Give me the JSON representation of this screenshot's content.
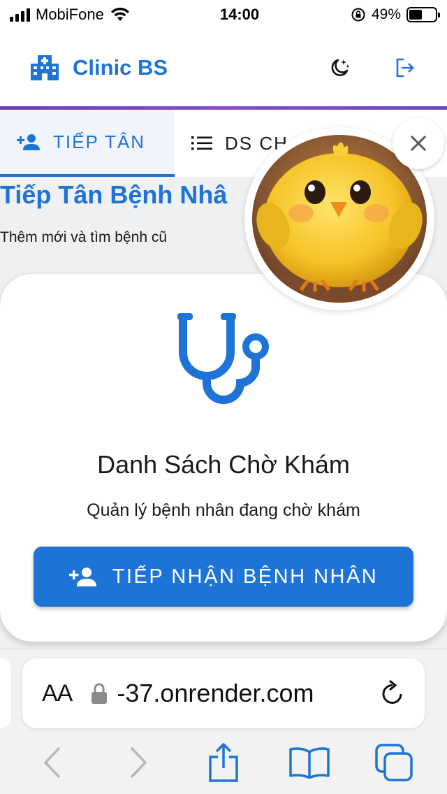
{
  "status_bar": {
    "carrier": "MobiFone",
    "time": "14:00",
    "battery_percent": "49%",
    "battery_level": 0.49
  },
  "app_bar": {
    "title": "Clinic BS",
    "logo_icon": "hospital-icon",
    "dark_mode_icon": "moon-stars-icon",
    "logout_icon": "logout-icon",
    "brand_color": "#1e74d6"
  },
  "tabs": [
    {
      "label": "TIẾP TÂN",
      "icon": "person-add-icon",
      "active": true
    },
    {
      "label": "DS CH",
      "icon": "list-icon",
      "active": false
    }
  ],
  "page": {
    "title": "Tiếp Tân Bệnh Nhâ",
    "subtitle": "Thêm mới và tìm bệnh cũ"
  },
  "card": {
    "icon": "stethoscope-icon",
    "title": "Danh Sách Chờ Khám",
    "description": "Quản lý bệnh nhân đang chờ khám",
    "button_label": "TIẾP NHẬN BỆNH NHÂN",
    "button_icon": "person-add-icon"
  },
  "floating_bubble": {
    "image": "yellow-chick-avatar",
    "close_icon": "close-icon"
  },
  "browser": {
    "text_size_label": "AA",
    "url": "-37.onrender.com",
    "toolbar_icons": [
      "back-icon",
      "forward-icon",
      "share-icon",
      "bookmarks-icon",
      "tabs-icon"
    ]
  }
}
